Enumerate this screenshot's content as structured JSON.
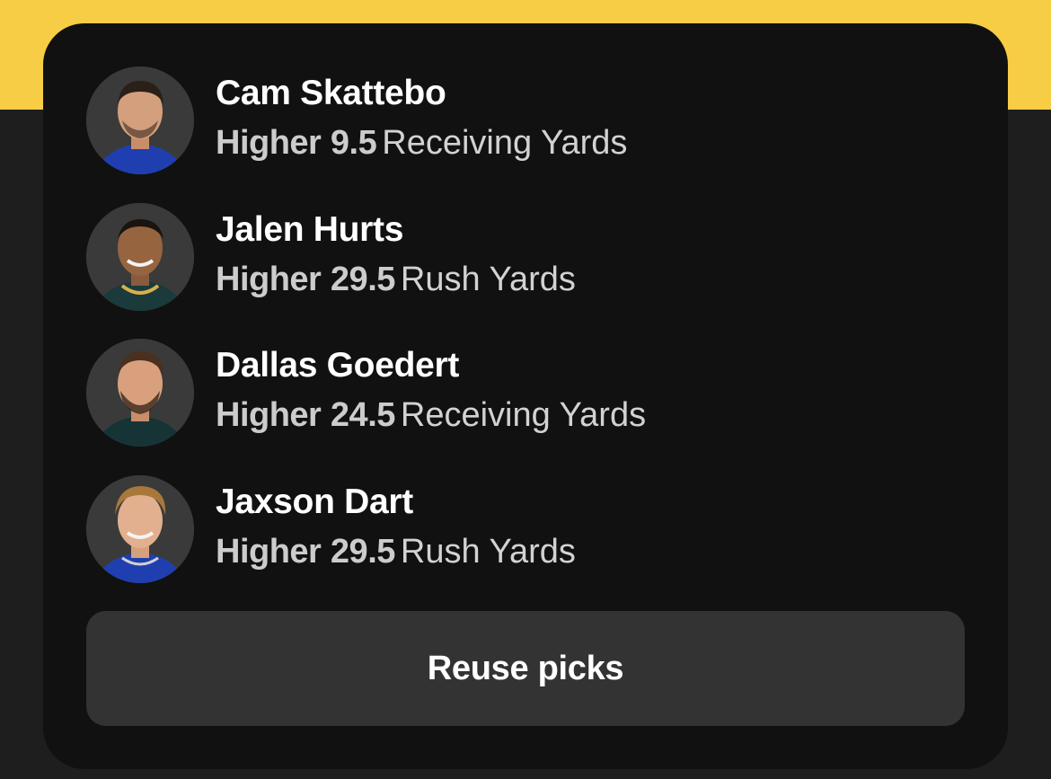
{
  "picks": [
    {
      "name": "Cam Skattebo",
      "direction": "Higher",
      "value": "9.5",
      "stat": "Receiving Yards",
      "jersey_color": "#1f3fb0",
      "avatar_icon": "player-headshot"
    },
    {
      "name": "Jalen Hurts",
      "direction": "Higher",
      "value": "29.5",
      "stat": "Rush Yards",
      "jersey_color": "#1a3a3c",
      "avatar_icon": "player-headshot"
    },
    {
      "name": "Dallas Goedert",
      "direction": "Higher",
      "value": "24.5",
      "stat": "Receiving Yards",
      "jersey_color": "#163436",
      "avatar_icon": "player-headshot"
    },
    {
      "name": "Jaxson Dart",
      "direction": "Higher",
      "value": "29.5",
      "stat": "Rush Yards",
      "jersey_color": "#1f3fb0",
      "avatar_icon": "player-headshot"
    }
  ],
  "button": {
    "label": "Reuse picks"
  },
  "colors": {
    "accent_yellow": "#f8cd46",
    "card": "#111111",
    "button_bg": "#333333"
  }
}
